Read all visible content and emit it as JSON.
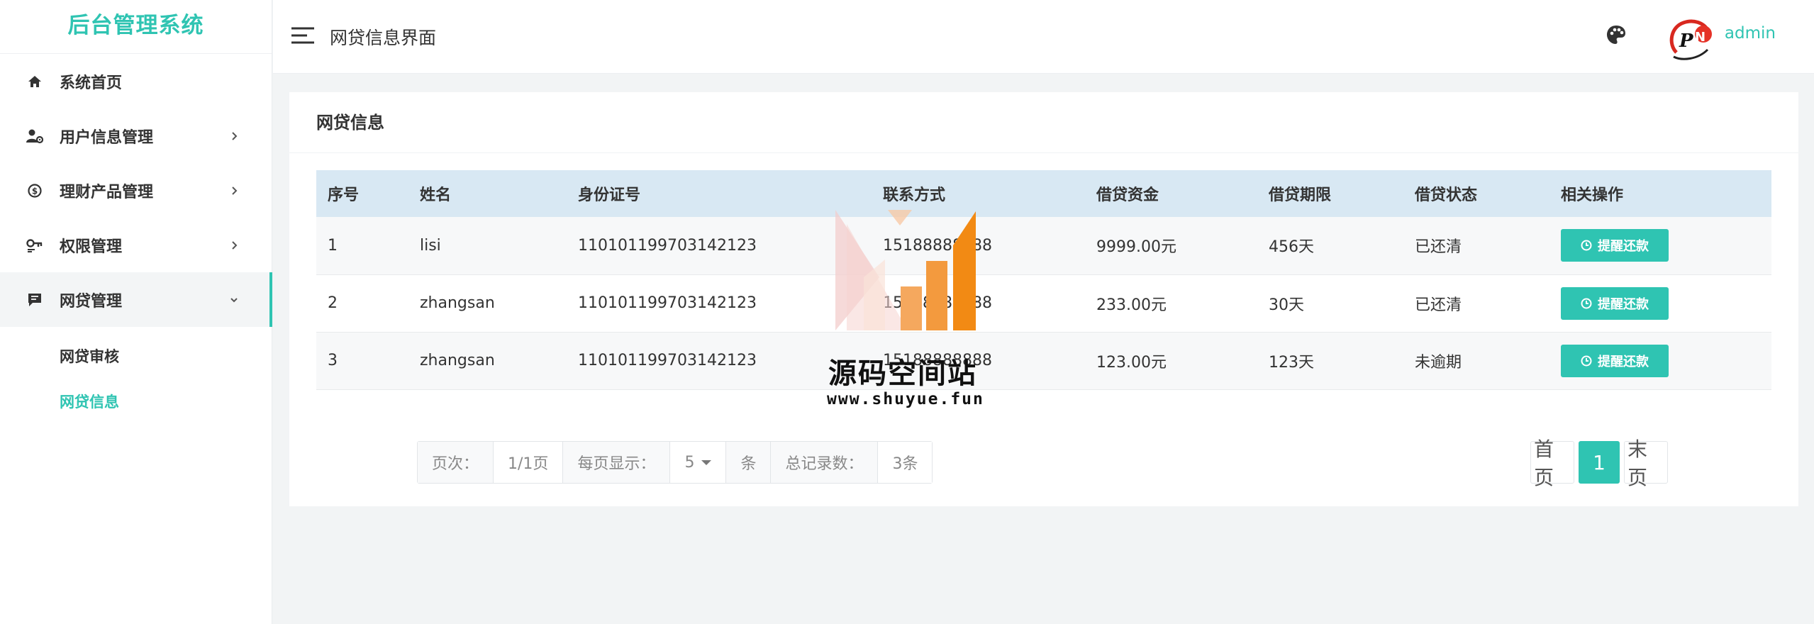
{
  "brand": "后台管理系统",
  "sidebar": {
    "items": [
      {
        "label": "系统首页",
        "icon": "home-icon"
      },
      {
        "label": "用户信息管理",
        "icon": "user-cog-icon"
      },
      {
        "label": "理财产品管理",
        "icon": "finance-icon"
      },
      {
        "label": "权限管理",
        "icon": "key-icon"
      },
      {
        "label": "网贷管理",
        "icon": "message-icon"
      }
    ],
    "subitems": [
      {
        "label": "网贷审核"
      },
      {
        "label": "网贷信息",
        "active": true
      }
    ]
  },
  "header": {
    "title": "网贷信息界面",
    "username": "admin"
  },
  "card": {
    "title": "网贷信息"
  },
  "table": {
    "columns": [
      "序号",
      "姓名",
      "身份证号",
      "联系方式",
      "借贷资金",
      "借贷期限",
      "借贷状态",
      "相关操作"
    ],
    "rows": [
      {
        "no": "1",
        "name": "lisi",
        "id": "110101199703142123",
        "phone": "15188888888",
        "amount": "9999.00元",
        "term": "456天",
        "status": "已还清",
        "action": "提醒还款"
      },
      {
        "no": "2",
        "name": "zhangsan",
        "id": "110101199703142123",
        "phone": "15188888888",
        "amount": "233.00元",
        "term": "30天",
        "status": "已还清",
        "action": "提醒还款"
      },
      {
        "no": "3",
        "name": "zhangsan",
        "id": "110101199703142123",
        "phone": "15188888888",
        "amount": "123.00元",
        "term": "123天",
        "status": "未逾期",
        "action": "提醒还款"
      }
    ]
  },
  "pagination": {
    "page_label": "页次：",
    "page_value": "1/1页",
    "per_page_label": "每页显示：",
    "per_page_value": "5",
    "per_page_unit": "条",
    "total_label": "总记录数：",
    "total_value": "3条",
    "first": "首页",
    "current": "1",
    "last": "末页"
  },
  "watermark": {
    "text": "源码空间站",
    "url": "www.shuyue.fun"
  },
  "colors": {
    "accent": "#2fc4b2",
    "table_header": "#d8e8f3"
  }
}
